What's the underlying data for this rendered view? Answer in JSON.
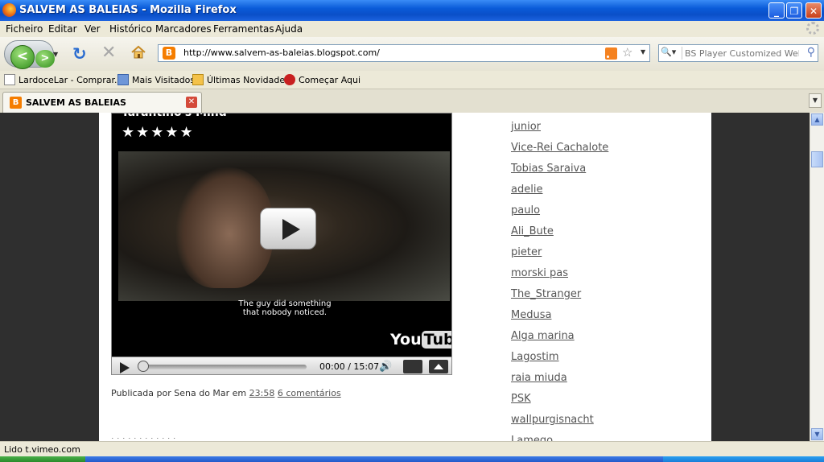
{
  "window": {
    "title": "SALVEM AS BALEIAS - Mozilla Firefox"
  },
  "menu": [
    "Ficheiro",
    "Editar",
    "Ver",
    "Histórico",
    "Marcadores",
    "Ferramentas",
    "Ajuda"
  ],
  "navbar": {
    "url": "http://www.salvem-as-baleias.blogspot.com/",
    "search_placeholder": "BS Player Customized Web Se"
  },
  "bookmarks": [
    "LardoceLar - Comprar...",
    "Mais Visitados",
    "Últimas Novidades",
    "Começar Aqui"
  ],
  "tab": {
    "title": "SALVEM AS BALEIAS"
  },
  "video": {
    "title": "Tarantino's Mind",
    "stars": "★★★★★",
    "subtitle": "The guy did something\nthat nobody noticed.",
    "logo_you": "You",
    "logo_tube": "Tube",
    "time": "00:00 / 15:07",
    "progress": 0
  },
  "post": {
    "prefix": "Publicada por Sena do Mar em",
    "time": "23:58",
    "comments": "6 comentários"
  },
  "followers": [
    "junior",
    "Vice-Rei Cachalote",
    "Tobias Saraiva",
    "adelie",
    "paulo",
    "Ali_Bute",
    "pieter",
    "morski pas",
    "The_Stranger",
    "Medusa",
    "Alga marina",
    "Lagostim",
    "raia miuda",
    "PSK",
    "wallpurgisnacht",
    "Lamego"
  ],
  "status": "Lido t.vimeo.com"
}
